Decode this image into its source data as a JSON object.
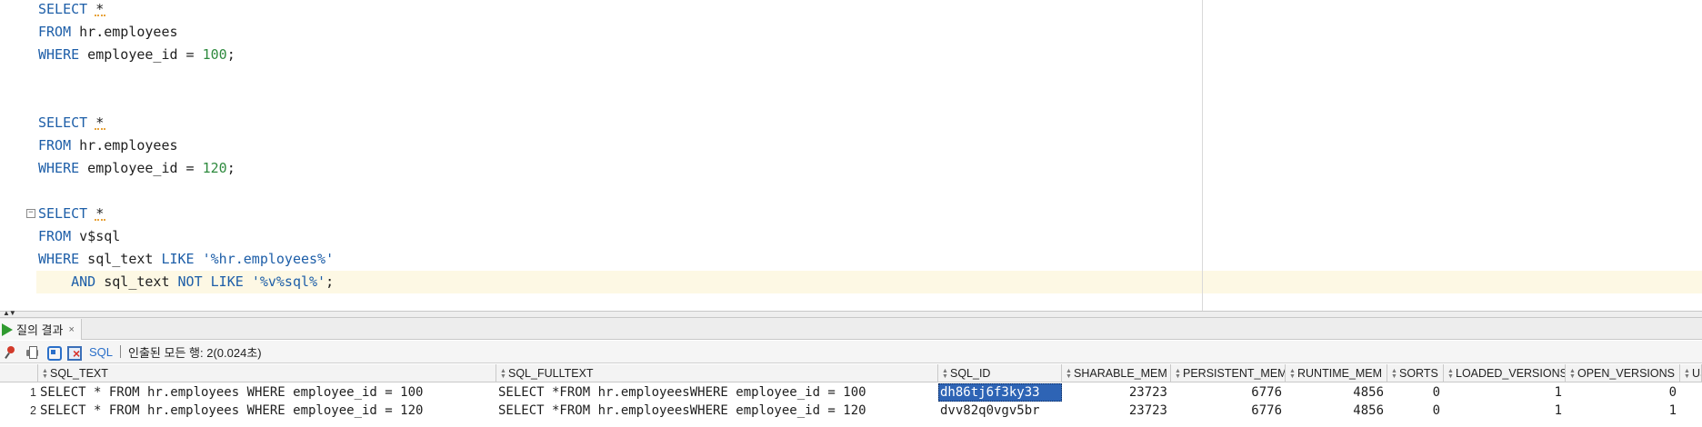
{
  "editor": {
    "lines": [
      {
        "tokens": [
          {
            "t": "SELECT",
            "c": "kw"
          },
          {
            "t": " "
          },
          {
            "t": "*",
            "c": "star"
          }
        ]
      },
      {
        "tokens": [
          {
            "t": "FROM",
            "c": "kw"
          },
          {
            "t": " hr.employees"
          }
        ]
      },
      {
        "tokens": [
          {
            "t": "WHERE",
            "c": "kw"
          },
          {
            "t": " employee_id = "
          },
          {
            "t": "100",
            "c": "num"
          },
          {
            "t": ";"
          }
        ]
      },
      {
        "tokens": []
      },
      {
        "tokens": []
      },
      {
        "tokens": [
          {
            "t": "SELECT",
            "c": "kw"
          },
          {
            "t": " "
          },
          {
            "t": "*",
            "c": "star"
          }
        ]
      },
      {
        "tokens": [
          {
            "t": "FROM",
            "c": "kw"
          },
          {
            "t": " hr.employees"
          }
        ]
      },
      {
        "tokens": [
          {
            "t": "WHERE",
            "c": "kw"
          },
          {
            "t": " employee_id = "
          },
          {
            "t": "120",
            "c": "num"
          },
          {
            "t": ";"
          }
        ]
      },
      {
        "tokens": []
      },
      {
        "tokens": [
          {
            "t": "SELECT",
            "c": "kw"
          },
          {
            "t": " "
          },
          {
            "t": "*",
            "c": "star"
          }
        ]
      },
      {
        "tokens": [
          {
            "t": "FROM",
            "c": "kw"
          },
          {
            "t": " v$sql"
          }
        ]
      },
      {
        "tokens": [
          {
            "t": "WHERE",
            "c": "kw"
          },
          {
            "t": " sql_text "
          },
          {
            "t": "LIKE",
            "c": "kw"
          },
          {
            "t": " "
          },
          {
            "t": "'%hr.employees%'",
            "c": "str"
          }
        ]
      },
      {
        "tokens": [
          {
            "t": "    "
          },
          {
            "t": "AND",
            "c": "kw"
          },
          {
            "t": " sql_text "
          },
          {
            "t": "NOT",
            "c": "kw"
          },
          {
            "t": " "
          },
          {
            "t": "LIKE",
            "c": "kw"
          },
          {
            "t": " "
          },
          {
            "t": "'%v%sql%'",
            "c": "str"
          },
          {
            "t": ";"
          }
        ]
      }
    ],
    "fold_marker": "−"
  },
  "results_tab": {
    "label": "질의 결과",
    "close": "×"
  },
  "toolbar": {
    "sql_label": "SQL",
    "separator": "|",
    "status": "인출된 모든 행: 2(0.024초)"
  },
  "grid": {
    "columns": [
      {
        "name": "SQL_TEXT"
      },
      {
        "name": "SQL_FULLTEXT"
      },
      {
        "name": "SQL_ID"
      },
      {
        "name": "SHARABLE_MEM"
      },
      {
        "name": "PERSISTENT_MEM"
      },
      {
        "name": "RUNTIME_MEM"
      },
      {
        "name": "SORTS"
      },
      {
        "name": "LOADED_VERSIONS"
      },
      {
        "name": "OPEN_VERSIONS"
      },
      {
        "name": "US"
      }
    ],
    "rows": [
      {
        "num": "1",
        "cells": [
          "SELECT * FROM hr.employees WHERE employee_id = 100",
          "SELECT *FROM hr.employeesWHERE employee_id = 100",
          "dh86tj6f3ky33",
          "23723",
          "6776",
          "4856",
          "0",
          "1",
          "0",
          ""
        ]
      },
      {
        "num": "2",
        "cells": [
          "SELECT * FROM hr.employees WHERE employee_id = 120",
          "SELECT *FROM hr.employeesWHERE employee_id = 120",
          "dvv82q0vgv5br",
          "23723",
          "6776",
          "4856",
          "0",
          "1",
          "1",
          ""
        ]
      }
    ],
    "selected_cell": {
      "row": 0,
      "col": 2
    }
  }
}
